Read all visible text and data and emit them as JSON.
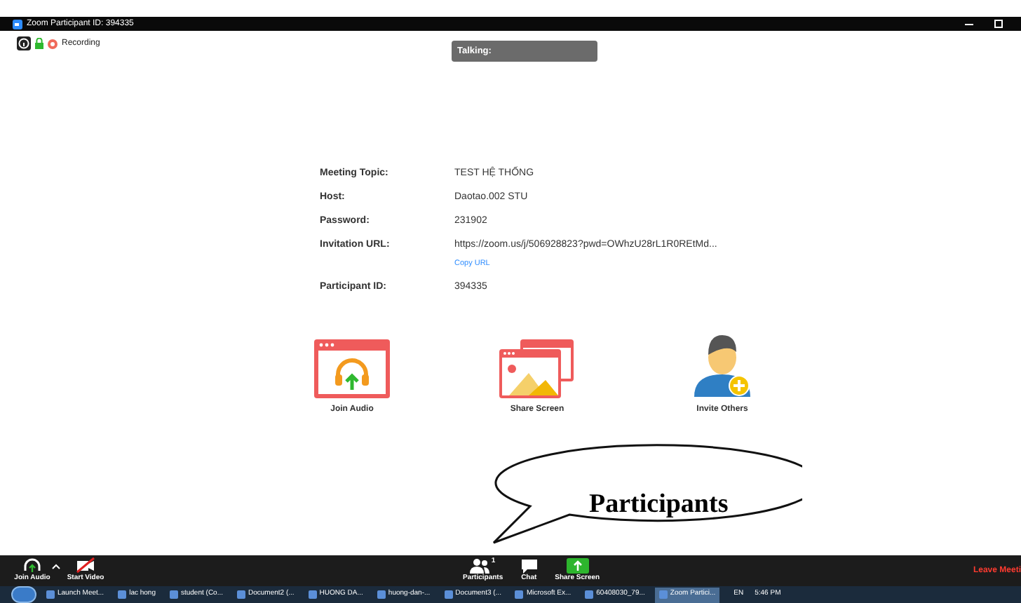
{
  "window": {
    "title": "Zoom Participant ID: 394335"
  },
  "status": {
    "recording": "Recording"
  },
  "talking": {
    "label": "Talking:"
  },
  "meeting_info": [
    {
      "label": "Meeting Topic:",
      "value": "TEST HỆ THỐNG"
    },
    {
      "label": "Host:",
      "value": "Daotao.002 STU"
    },
    {
      "label": "Password:",
      "value": "231902"
    },
    {
      "label": "Invitation URL:",
      "value": "https://zoom.us/j/506928823?pwd=OWhzU28rL1R0REtMd...",
      "link": "Copy URL"
    },
    {
      "label": "Participant ID:",
      "value": "394335"
    }
  ],
  "actions": [
    {
      "kind": "audio",
      "label": "Join Audio"
    },
    {
      "kind": "share",
      "label": "Share Screen"
    },
    {
      "kind": "invite",
      "label": "Invite Others"
    }
  ],
  "callout": {
    "text": "Participants"
  },
  "toolbar": {
    "left": [
      {
        "kind": "audio",
        "label": "Join Audio"
      },
      {
        "kind": "video",
        "label": "Start Video"
      }
    ],
    "center": [
      {
        "kind": "participants",
        "label": "Participants",
        "count": "1"
      },
      {
        "kind": "chat",
        "label": "Chat"
      },
      {
        "kind": "share",
        "label": "Share Screen"
      }
    ],
    "leave": "Leave Meeti"
  },
  "taskbar": {
    "items": [
      {
        "label": "Launch Meet...",
        "selected": false
      },
      {
        "label": "lac hong",
        "selected": false
      },
      {
        "label": "student (Co...",
        "selected": false
      },
      {
        "label": "Document2 (...",
        "selected": false
      },
      {
        "label": "HUONG DA...",
        "selected": false
      },
      {
        "label": "huong-dan-...",
        "selected": false
      },
      {
        "label": "Document3 (...",
        "selected": false
      },
      {
        "label": "Microsoft Ex...",
        "selected": false
      },
      {
        "label": "60408030_79...",
        "selected": false
      },
      {
        "label": "Zoom Partici...",
        "selected": true
      }
    ],
    "language": "EN",
    "clock": "5:46 PM"
  }
}
